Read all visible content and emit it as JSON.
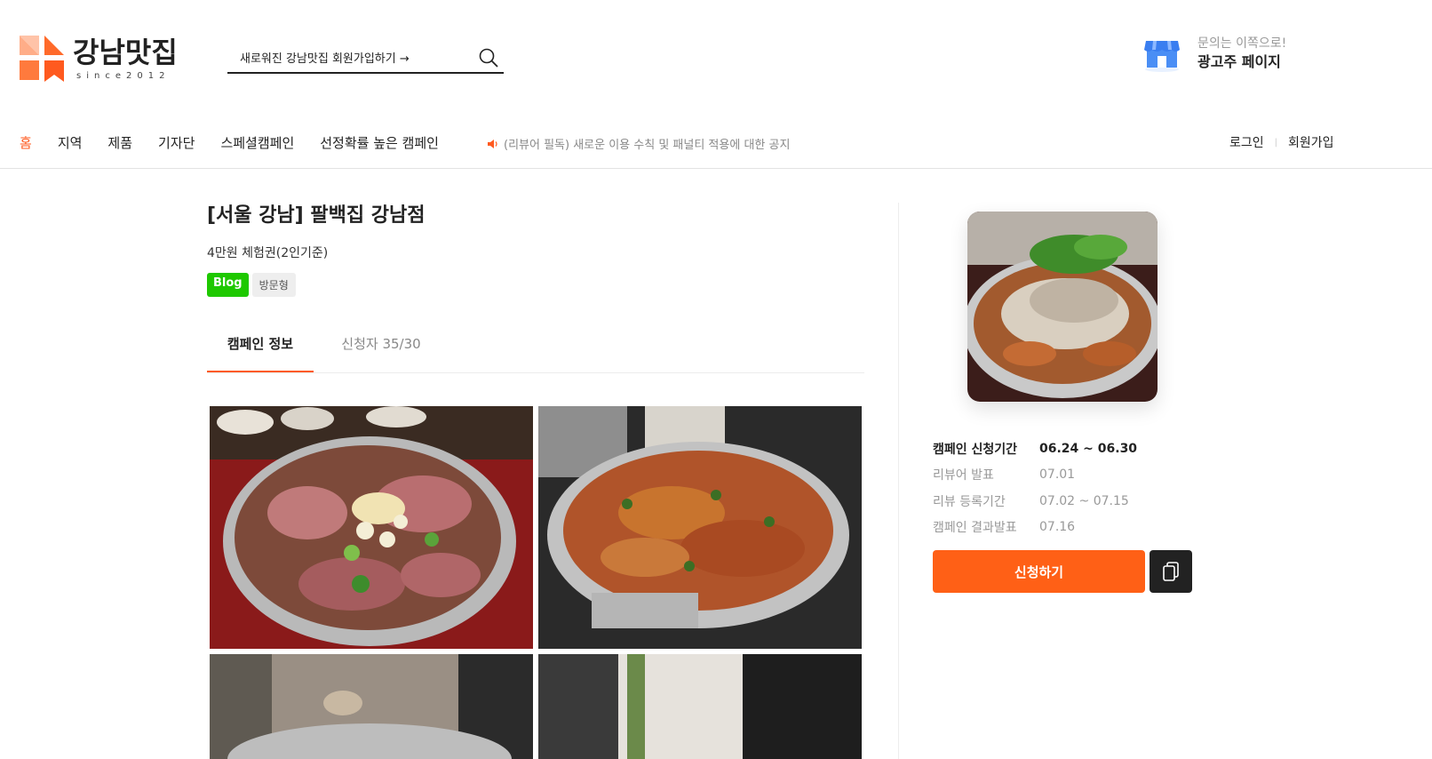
{
  "header": {
    "logo_title": "강남맛집",
    "logo_since": "since2012",
    "search_text": "새로워진 강남맛집 회원가입하기 →",
    "ad_sub": "문의는 이쪽으로!",
    "ad_main": "광고주 페이지"
  },
  "nav": {
    "items": [
      "홈",
      "지역",
      "제품",
      "기자단",
      "스페셜캠페인",
      "선정확률 높은 캠페인"
    ],
    "notice": "(리뷰어 필독) 새로운 이용 수칙 및 패널티 적용에 대한 공지",
    "login": "로그인",
    "auth_sep": "|",
    "signup": "회원가입"
  },
  "campaign": {
    "title": "[서울 강남] 팔백집 강남점",
    "subtitle": "4만원 체험권(2인기준)",
    "badge_blog": "Blog",
    "badge_type": "방문형",
    "tabs": [
      "캠페인 정보",
      "신청자 35/30"
    ]
  },
  "schedule": [
    {
      "label": "캠페인 신청기간",
      "value": "06.24 ~ 06.30"
    },
    {
      "label": "리뷰어 발표",
      "value": "07.01"
    },
    {
      "label": "리뷰 등록기간",
      "value": "07.02 ~ 07.15"
    },
    {
      "label": "캠페인 결과발표",
      "value": "07.16"
    }
  ],
  "actions": {
    "apply": "신청하기"
  },
  "colors": {
    "accent": "#ff6016",
    "blog_badge": "#1ec800",
    "dark": "#222222"
  },
  "icons": {
    "search": "search-icon",
    "shop": "shop-icon",
    "speaker": "speaker-icon",
    "copy": "copy-icon"
  }
}
